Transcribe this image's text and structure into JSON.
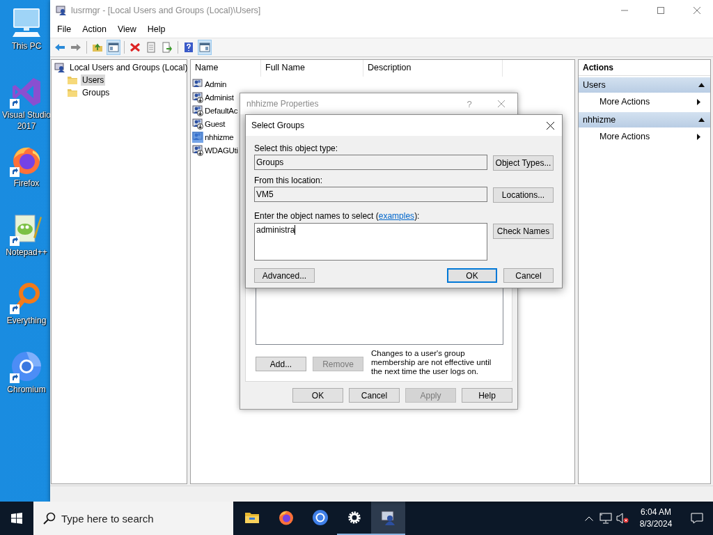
{
  "desktop_icons": [
    {
      "label": "This PC",
      "kind": "pc",
      "shortcut": false
    },
    {
      "label": "Visual Studio 2017",
      "kind": "vs",
      "shortcut": true
    },
    {
      "label": "Firefox",
      "kind": "firefox",
      "shortcut": true
    },
    {
      "label": "Notepad++",
      "kind": "notepad",
      "shortcut": true
    },
    {
      "label": "Everything",
      "kind": "everything",
      "shortcut": true
    },
    {
      "label": "Chromium",
      "kind": "chromium",
      "shortcut": true
    }
  ],
  "window": {
    "title": "lusrmgr - [Local Users and Groups (Local)\\Users]",
    "active": false,
    "menu": [
      "File",
      "Action",
      "View",
      "Help"
    ],
    "toolbar": [
      {
        "kind": "back",
        "on": false
      },
      {
        "kind": "forward",
        "on": false
      },
      {
        "kind": "separator"
      },
      {
        "kind": "up",
        "on": false
      },
      {
        "kind": "console-tree",
        "on": true
      },
      {
        "kind": "separator"
      },
      {
        "kind": "delete",
        "on": false
      },
      {
        "kind": "properties",
        "on": false
      },
      {
        "kind": "export",
        "on": false
      },
      {
        "kind": "separator"
      },
      {
        "kind": "help",
        "on": false
      },
      {
        "kind": "action-pane",
        "on": true
      }
    ],
    "tree": {
      "label": "Local Users and Groups (Local)",
      "children": [
        {
          "label": "Users",
          "selected": true
        },
        {
          "label": "Groups",
          "selected": false
        }
      ]
    },
    "list": {
      "columns": [
        "Name",
        "Full Name",
        "Description"
      ],
      "rows": [
        {
          "name": "Admin",
          "disabled": false,
          "selected": false
        },
        {
          "name": "Administ",
          "disabled": true,
          "selected": false
        },
        {
          "name": "DefaultAc",
          "disabled": true,
          "selected": false
        },
        {
          "name": "Guest",
          "disabled": true,
          "selected": false
        },
        {
          "name": "nhhizme",
          "disabled": false,
          "selected": true
        },
        {
          "name": "WDAGUti",
          "disabled": true,
          "selected": false
        }
      ]
    },
    "actions": {
      "title": "Actions",
      "sections": [
        {
          "title": "Users",
          "expanded": true,
          "items": [
            "More Actions"
          ]
        },
        {
          "title": "nhhizme",
          "expanded": true,
          "items": [
            "More Actions"
          ]
        }
      ]
    }
  },
  "properties_dialog": {
    "title": "nhhizme Properties",
    "help_glyph": "?",
    "member_buttons": [
      {
        "label": "Add...",
        "disabled": false
      },
      {
        "label": "Remove",
        "disabled": true
      }
    ],
    "note": "Changes to a user's group membership are not effective until the next time the user logs on.",
    "buttons": [
      {
        "label": "OK",
        "disabled": false
      },
      {
        "label": "Cancel",
        "disabled": false
      },
      {
        "label": "Apply",
        "disabled": true
      },
      {
        "label": "Help",
        "disabled": false
      }
    ]
  },
  "select_groups": {
    "title": "Select Groups",
    "object_type": {
      "label": "Select this object type:",
      "value": "Groups",
      "button": "Object Types..."
    },
    "location": {
      "label": "From this location:",
      "value": "VM5",
      "button": "Locations..."
    },
    "names": {
      "label_before": "Enter the object names to select (",
      "link": "examples",
      "label_after": "):",
      "value": "administra",
      "button": "Check Names"
    },
    "buttons": [
      {
        "label": "Advanced...",
        "default": false
      },
      {
        "label": "OK",
        "default": true
      },
      {
        "label": "Cancel",
        "default": false
      }
    ]
  },
  "taskbar": {
    "search": {
      "placeholder": "Type here to search"
    },
    "apps": [
      {
        "kind": "explorer",
        "running": false,
        "active": false
      },
      {
        "kind": "firefox",
        "running": false,
        "active": false
      },
      {
        "kind": "chromium",
        "running": false,
        "active": false
      },
      {
        "kind": "settings",
        "running": true,
        "active": false
      },
      {
        "kind": "mmc",
        "running": true,
        "active": true
      }
    ],
    "time": "6:04 AM",
    "date": "8/3/2024"
  }
}
